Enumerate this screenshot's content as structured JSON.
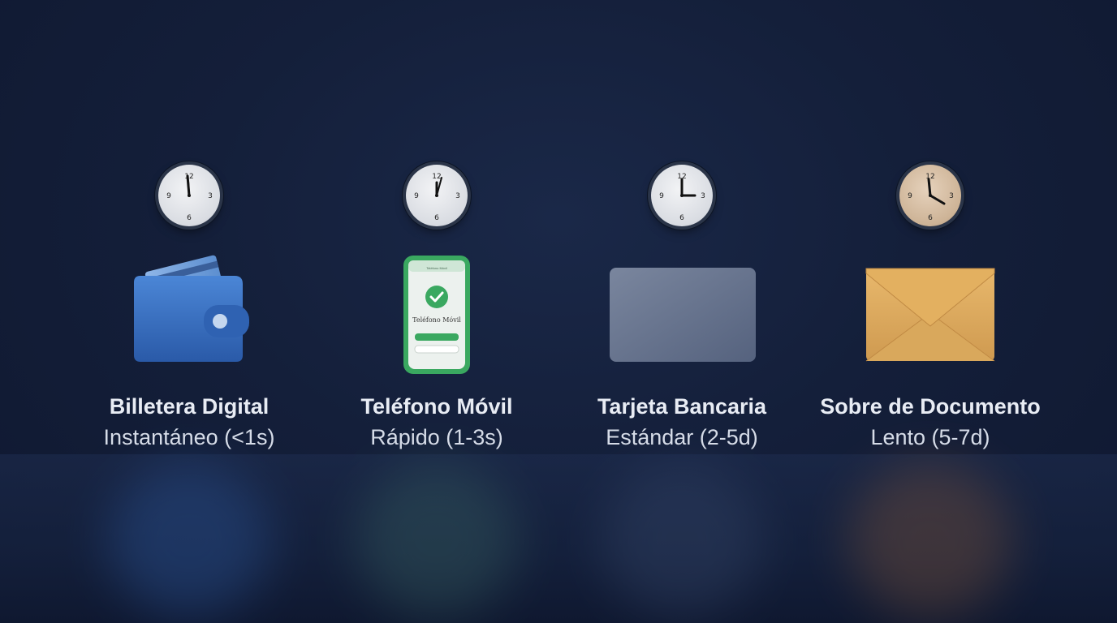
{
  "items": [
    {
      "title": "Billetera Digital",
      "speed": "Instantáneo (<1s)",
      "icon": "wallet-icon",
      "accent": "#3a6fc2"
    },
    {
      "title": "Teléfono Móvil",
      "speed": "Rápido (1-3s)",
      "icon": "phone-icon",
      "accent": "#3fa864",
      "phone": {
        "header": "Teléfono Móvil",
        "screen_text": "Teléfono Móvil"
      }
    },
    {
      "title": "Tarjeta Bancaria",
      "speed": "Estándar (2-5d)",
      "icon": "card-icon",
      "accent": "#5e6c88"
    },
    {
      "title": "Sobre de Documento",
      "speed": "Lento (5-7d)",
      "icon": "envelope-icon",
      "accent": "#d9a55c"
    }
  ],
  "colors": {
    "background": "#141f3a",
    "text": "#e8ecf4"
  }
}
